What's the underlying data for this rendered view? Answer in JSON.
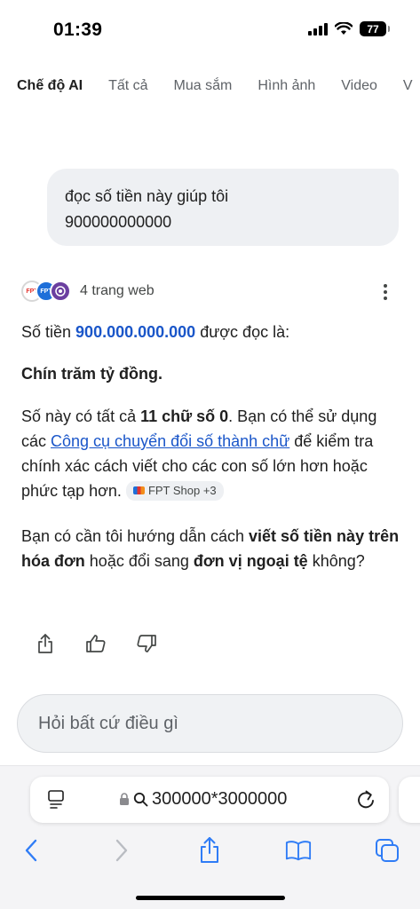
{
  "status_bar": {
    "time": "01:39",
    "battery": "77",
    "icons": [
      "cellular-signal-icon",
      "wifi-icon",
      "battery-icon"
    ]
  },
  "tabs": [
    {
      "label": "Chế độ AI",
      "active": true
    },
    {
      "label": "Tất cả",
      "active": false
    },
    {
      "label": "Mua sắm",
      "active": false
    },
    {
      "label": "Hình ảnh",
      "active": false
    },
    {
      "label": "Video",
      "active": false
    },
    {
      "label": "V",
      "active": false
    }
  ],
  "user_message": {
    "line1": "đọc số tiền này giúp tôi",
    "line2": "900000000000"
  },
  "sources": {
    "label": "4 trang web",
    "favicons": [
      "FPT",
      "FPT",
      "seal"
    ]
  },
  "answer": {
    "p1_before": "Số tiền ",
    "p1_amount": "900.000.000.000",
    "p1_after": " được đọc là:",
    "p2": "Chín trăm tỷ đồng.",
    "p3_a": "Số này có tất cả ",
    "p3_bold": "11 chữ số 0",
    "p3_b": ". Bạn có thể sử dụng các ",
    "p3_link": "Công cụ chuyển đổi số thành chữ",
    "p3_c": " để kiểm tra chính xác cách viết cho các con số lớn hơn hoặc phức tạp hơn.",
    "citation_chip": "FPT Shop +3",
    "p4_a": "Bạn có cần tôi hướng dẫn cách ",
    "p4_bold1": "viết số tiền này trên hóa đơn",
    "p4_b": " hoặc đổi sang ",
    "p4_bold2": "đơn vị ngoại tệ",
    "p4_c": " không?"
  },
  "feedback_icons": [
    "share-icon",
    "thumbs-up-icon",
    "thumbs-down-icon"
  ],
  "ask_box": {
    "placeholder": "Hỏi bất cứ điều gì"
  },
  "browser": {
    "url_text": "300000*3000000",
    "toolbar_icons": [
      "back-icon",
      "forward-icon",
      "share-icon",
      "bookmarks-icon",
      "tabs-icon"
    ]
  },
  "colors": {
    "accent_blue": "#1a56c9",
    "bubble_bg": "#eef0f3",
    "toolbar_blue": "#2f7cf6"
  }
}
